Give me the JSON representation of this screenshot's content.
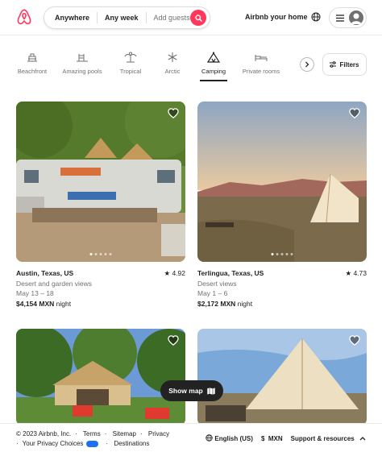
{
  "header": {
    "search": {
      "where": "Anywhere",
      "when": "Any week",
      "guests": "Add guests"
    },
    "host_link": "Airbnb your home"
  },
  "categories": [
    {
      "label": "Beachfront",
      "icon": "beachfront-icon"
    },
    {
      "label": "Amazing pools",
      "icon": "pool-icon"
    },
    {
      "label": "Tropical",
      "icon": "palm-tree-icon"
    },
    {
      "label": "Arctic",
      "icon": "snowflake-icon"
    },
    {
      "label": "Camping",
      "icon": "camping-icon",
      "active": true
    },
    {
      "label": "Private rooms",
      "icon": "bed-icon"
    }
  ],
  "filters_label": "Filters",
  "listings": [
    {
      "title": "Austin, Texas, US",
      "rating": "4.92",
      "desc": "Desert and garden views",
      "dates": "May 13 – 18",
      "price": "$4,154 MXN",
      "unit": "night"
    },
    {
      "title": "Terlingua, Texas, US",
      "rating": "4.73",
      "desc": "Desert views",
      "dates": "May 1 – 6",
      "price": "$2,172 MXN",
      "unit": "night"
    },
    {
      "title": "",
      "rating": "",
      "desc": "",
      "dates": "",
      "price": "",
      "unit": ""
    },
    {
      "title": "",
      "rating": "",
      "desc": "",
      "dates": "",
      "price": "",
      "unit": ""
    }
  ],
  "show_map": "Show map",
  "footer": {
    "copyright": "© 2023 Airbnb, Inc.",
    "links": [
      "Terms",
      "Sitemap",
      "Privacy"
    ],
    "privacy_choices": "Your Privacy Choices",
    "destinations": "Destinations",
    "language": "English (US)",
    "currency_symbol": "$",
    "currency": "MXN",
    "support": "Support & resources"
  },
  "colors": {
    "brand": "#ff385c",
    "text": "#222222",
    "muted": "#717171"
  }
}
